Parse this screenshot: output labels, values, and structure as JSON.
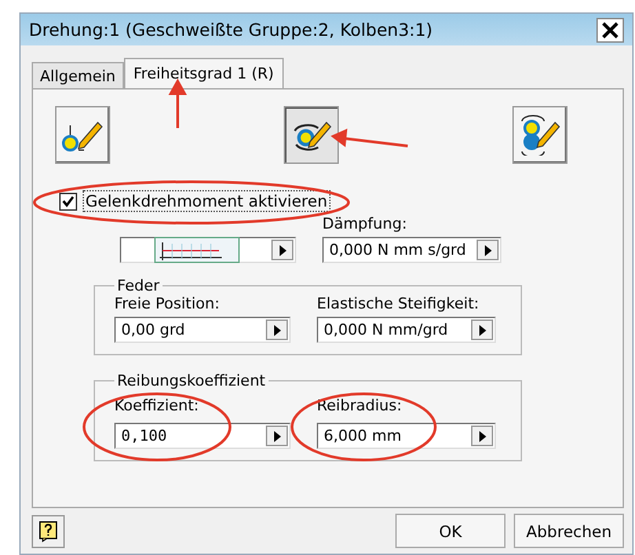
{
  "window": {
    "title": "Drehung:1 (Geschweißte Gruppe:2, Kolben3:1)"
  },
  "tabs": [
    {
      "label": "Allgemein",
      "selected": false
    },
    {
      "label": "Freiheitsgrad 1 (R)",
      "selected": true
    }
  ],
  "mode_buttons": [
    {
      "kind": "point",
      "selected": false
    },
    {
      "kind": "rotate",
      "selected": true
    },
    {
      "kind": "pair",
      "selected": false
    }
  ],
  "torque": {
    "label": "Gelenkdrehmoment aktivieren",
    "checked": true
  },
  "damping": {
    "label": "Dämpfung:",
    "value": "0,000 N mm s/grd"
  },
  "spring": {
    "title": "Feder",
    "fields": [
      {
        "label": "Freie Position:",
        "value": "0,00 grd"
      },
      {
        "label": "Elastische Steifigkeit:",
        "value": "0,000 N mm/grd"
      }
    ]
  },
  "friction": {
    "title": "Reibungskoeffizient",
    "fields": [
      {
        "label": "Koeffizient:",
        "value": "0,100",
        "mono": true
      },
      {
        "label": "Reibradius:",
        "value": "6,000 mm",
        "mono": false
      }
    ]
  },
  "buttons": [
    "OK",
    "Abbrechen"
  ]
}
